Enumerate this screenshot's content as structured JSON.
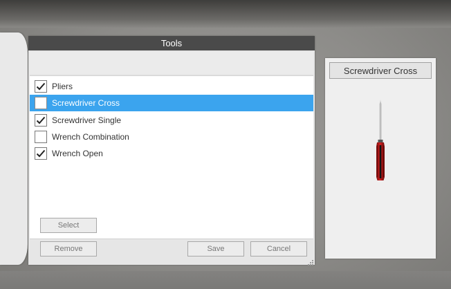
{
  "window": {
    "title": "Tools"
  },
  "tools": [
    {
      "label": "Pliers",
      "checked": true,
      "selected": false
    },
    {
      "label": "Screwdriver Cross",
      "checked": false,
      "selected": true
    },
    {
      "label": "Screwdriver Single",
      "checked": true,
      "selected": false
    },
    {
      "label": "Wrench Combination",
      "checked": false,
      "selected": false
    },
    {
      "label": "Wrench Open",
      "checked": true,
      "selected": false
    }
  ],
  "buttons": {
    "select": "Select",
    "remove": "Remove",
    "save": "Save",
    "cancel": "Cancel"
  },
  "preview": {
    "title": "Screwdriver Cross",
    "image_icon": "screwdriver-icon",
    "handle_color": "#c41a1a"
  },
  "colors": {
    "selection": "#3ba4ee",
    "title_bar": "#4a4a4a"
  }
}
